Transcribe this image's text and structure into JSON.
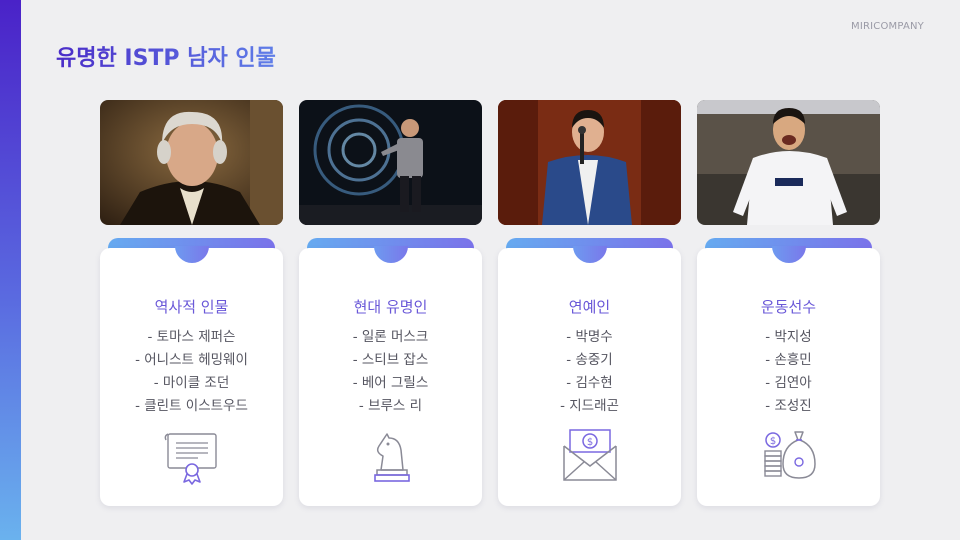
{
  "header": {
    "company": "MIRICOMPANY",
    "title": "유명한 ISTP 남자 인물"
  },
  "colors": {
    "accent_purple": "#6a58d8",
    "accent_blue": "#66aaf0",
    "background": "#efeff1"
  },
  "cards": [
    {
      "photo": "portrait-historical-figure",
      "title": "역사적 인물",
      "items": [
        "- 토마스 제퍼슨",
        "- 어니스트 헤밍웨이",
        "- 마이클 조던",
        "- 클린트 이스트우드"
      ],
      "icon": "certificate-icon"
    },
    {
      "photo": "presenter-on-stage",
      "title": "현대 유명인",
      "items": [
        "- 일론 머스크",
        "- 스티브 잡스",
        "- 베어 그릴스",
        "- 브루스 리"
      ],
      "icon": "chess-knight-icon"
    },
    {
      "photo": "speaker-with-microphone",
      "title": "연예인",
      "items": [
        "- 박명수",
        "- 송중기",
        "- 김수현",
        "- 지드래곤"
      ],
      "icon": "money-envelope-icon"
    },
    {
      "photo": "soccer-player-celebrating",
      "title": "운동선수",
      "items": [
        "- 박지성",
        "- 손흥민",
        "- 김연아",
        "- 조성진"
      ],
      "icon": "money-bag-coins-icon"
    }
  ]
}
